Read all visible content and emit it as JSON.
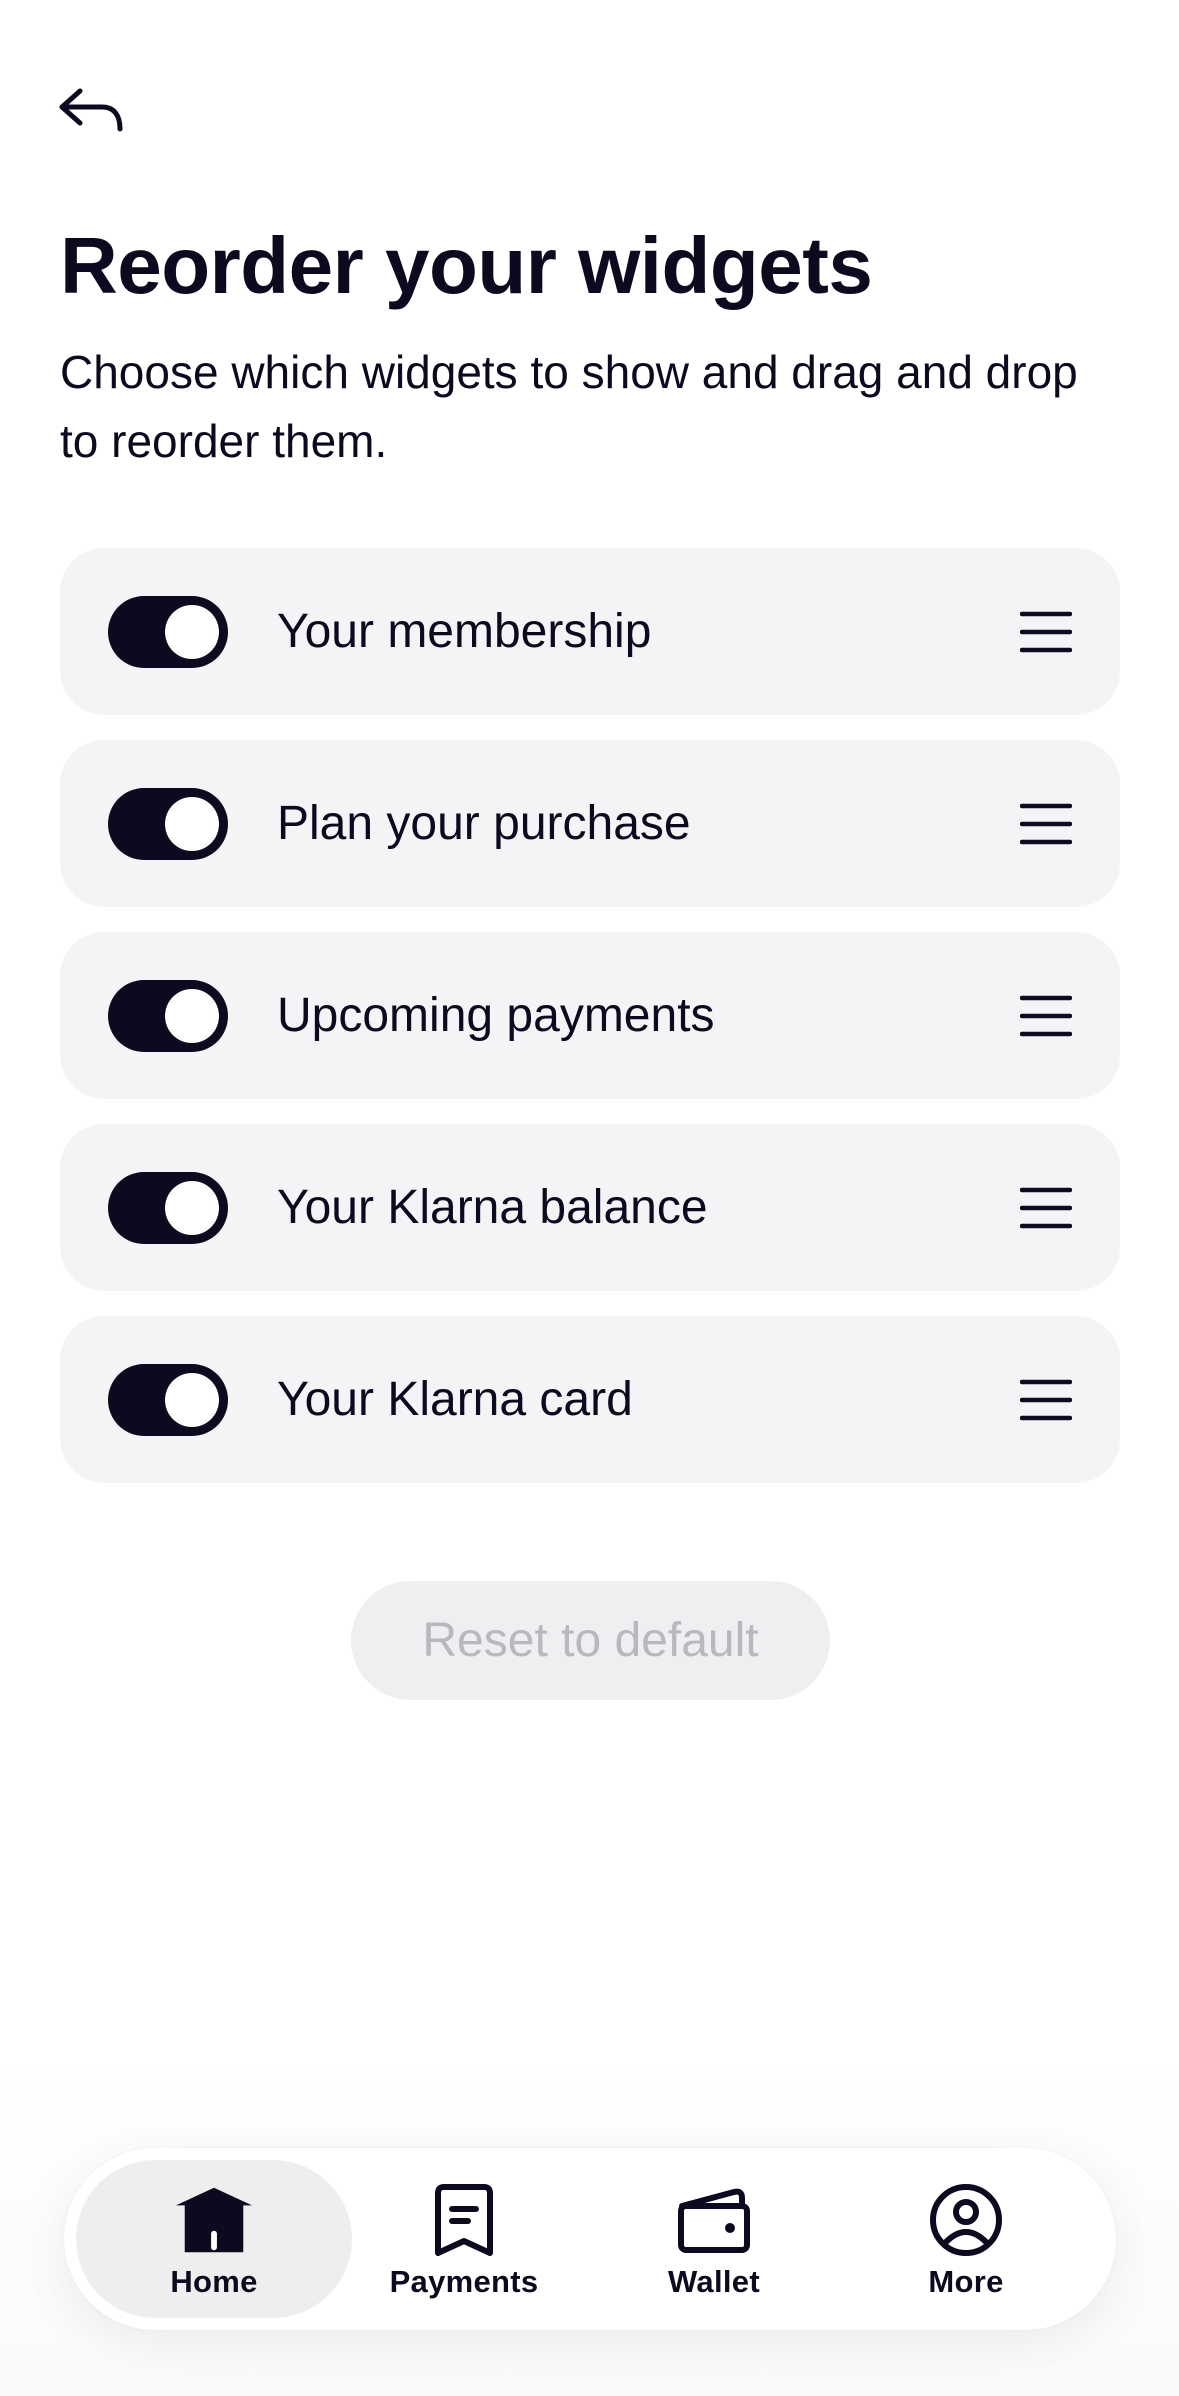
{
  "header": {
    "back_icon": "back-arrow-icon",
    "title": "Reorder your widgets",
    "subtitle": "Choose which widgets to show and drag and drop to reorder them."
  },
  "widgets": [
    {
      "label": "Your membership",
      "enabled": true
    },
    {
      "label": "Plan your purchase",
      "enabled": true
    },
    {
      "label": "Upcoming payments",
      "enabled": true
    },
    {
      "label": "Your Klarna balance",
      "enabled": true
    },
    {
      "label": "Your Klarna card",
      "enabled": true
    }
  ],
  "reset_button": {
    "label": "Reset to default",
    "disabled": true
  },
  "nav": {
    "active": "Home",
    "items": [
      {
        "label": "Home",
        "icon": "home-icon"
      },
      {
        "label": "Payments",
        "icon": "receipt-icon"
      },
      {
        "label": "Wallet",
        "icon": "wallet-icon"
      },
      {
        "label": "More",
        "icon": "user-circle-icon"
      }
    ]
  },
  "colors": {
    "primary": "#0b0a1f",
    "row_bg": "#f4f4f6",
    "disabled_text": "#b8b8bd"
  }
}
